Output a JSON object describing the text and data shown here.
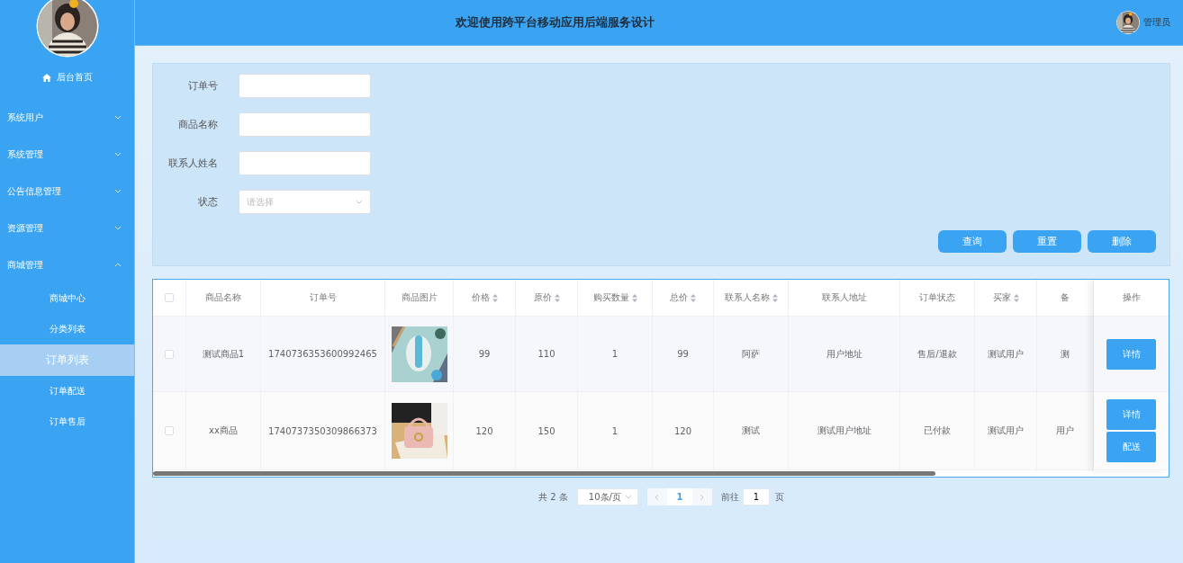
{
  "header": {
    "title": "欢迎使用跨平台移动应用后端服务设计",
    "user": "管理员"
  },
  "sidebar": {
    "items": [
      {
        "kind": "home",
        "label": "后台首页"
      },
      {
        "kind": "group",
        "label": "系统用户",
        "expanded": false
      },
      {
        "kind": "group",
        "label": "系统管理",
        "expanded": false
      },
      {
        "kind": "group",
        "label": "公告信息管理",
        "expanded": false
      },
      {
        "kind": "group",
        "label": "资源管理",
        "expanded": false
      },
      {
        "kind": "group",
        "label": "商城管理",
        "expanded": true,
        "children": [
          {
            "label": "商城中心",
            "selected": false
          },
          {
            "label": "分类列表",
            "selected": false
          },
          {
            "label": "订单列表",
            "selected": true
          },
          {
            "label": "订单配送",
            "selected": false
          },
          {
            "label": "订单售后",
            "selected": false
          }
        ]
      }
    ]
  },
  "search": {
    "fields": [
      {
        "kind": "input",
        "label": "订单号"
      },
      {
        "kind": "input",
        "label": "商品名称"
      },
      {
        "kind": "input",
        "label": "联系人姓名"
      },
      {
        "kind": "select",
        "label": "状态",
        "placeholder": "请选择"
      }
    ],
    "buttons": [
      "查询",
      "重置",
      "删除"
    ]
  },
  "table": {
    "select_all_checked": false,
    "columns": [
      {
        "label": "商品名称",
        "sortable": false
      },
      {
        "label": "订单号",
        "sortable": false
      },
      {
        "label": "商品图片",
        "sortable": false
      },
      {
        "label": "价格",
        "sortable": true
      },
      {
        "label": "原价",
        "sortable": true
      },
      {
        "label": "购买数量",
        "sortable": true
      },
      {
        "label": "总价",
        "sortable": true
      },
      {
        "label": "联系人名称",
        "sortable": true
      },
      {
        "label": "联系人地址",
        "sortable": false
      },
      {
        "label": "订单状态",
        "sortable": false
      },
      {
        "label": "买家",
        "sortable": true
      },
      {
        "label": "备",
        "sortable": false
      },
      {
        "label": "操作",
        "sortable": false
      }
    ],
    "rows": [
      {
        "checked": false,
        "cells": [
          "测试商品1",
          "1740736353600992465",
          {
            "kind": "picture"
          },
          "99",
          "110",
          "1",
          "99",
          "阿萨",
          "用户地址",
          "售后/退款",
          "测试用户",
          "测"
        ],
        "actions": [
          "详情"
        ]
      },
      {
        "checked": false,
        "cells": [
          "xx商品",
          "1740737350309866373",
          {
            "kind": "picture"
          },
          "120",
          "150",
          "1",
          "120",
          "测试",
          "测试用户地址",
          "已付款",
          "测试用户",
          "用户"
        ],
        "actions": [
          "详情",
          "配送"
        ]
      }
    ]
  },
  "pagination": {
    "total": "共 2 条",
    "page_size": "10条/页",
    "pages": [
      {
        "label": "1",
        "selected": true
      }
    ],
    "goto_label": "前往",
    "goto_value": "1",
    "goto_suffix": "页"
  }
}
